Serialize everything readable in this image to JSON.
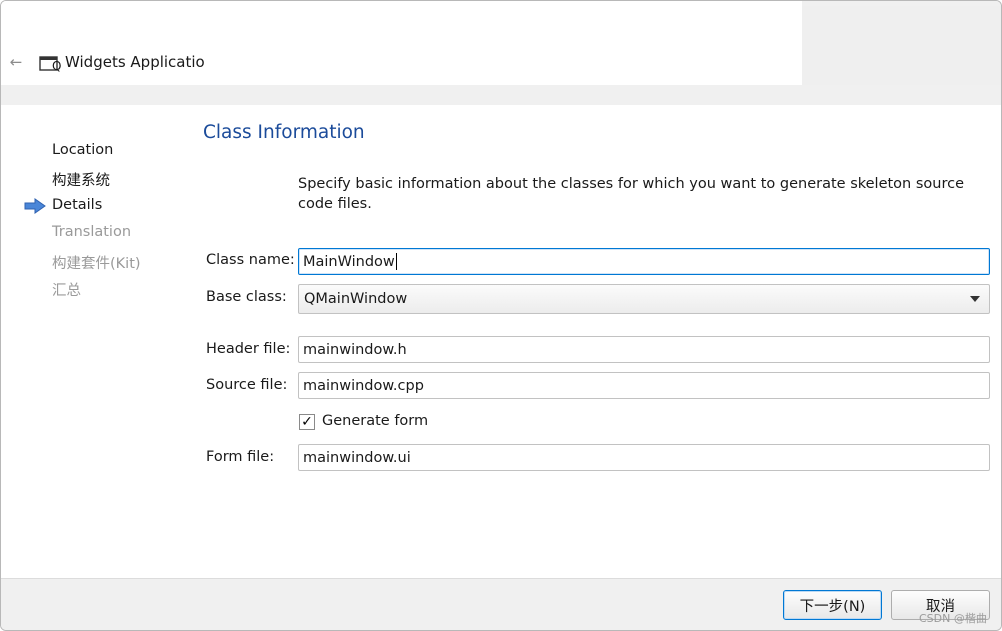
{
  "window": {
    "title": "Widgets Applicatio",
    "back_icon": "back-arrow-icon",
    "app_icon": "qt-app-icon"
  },
  "nav": {
    "steps": [
      {
        "label": "Location",
        "state": "done"
      },
      {
        "label": "构建系统",
        "state": "done"
      },
      {
        "label": "Details",
        "state": "current"
      },
      {
        "label": "Translation",
        "state": "todo"
      },
      {
        "label": "构建套件(Kit)",
        "state": "todo"
      },
      {
        "label": "汇总",
        "state": "todo"
      }
    ],
    "current_indicator_icon": "current-step-arrow-icon",
    "indicator_color": "#4a86d8"
  },
  "page": {
    "title": "Class Information",
    "title_color": "#1b4b9a",
    "description": "Specify basic information about the classes for which you want to generate skeleton source code files."
  },
  "form": {
    "class_name": {
      "label": "Class name:",
      "value": "MainWindow"
    },
    "base_class": {
      "label": "Base class:",
      "value": "QMainWindow"
    },
    "header_file": {
      "label": "Header file:",
      "value": "mainwindow.h"
    },
    "source_file": {
      "label": "Source file:",
      "value": "mainwindow.cpp"
    },
    "generate_form": {
      "label": "Generate form",
      "checked": true
    },
    "form_file": {
      "label": "Form file:",
      "value": "mainwindow.ui"
    }
  },
  "footer": {
    "next_label": "下一步(N)",
    "cancel_label": "取消",
    "focus_color": "#0078d4"
  },
  "watermark": "CSDN @楷曲"
}
